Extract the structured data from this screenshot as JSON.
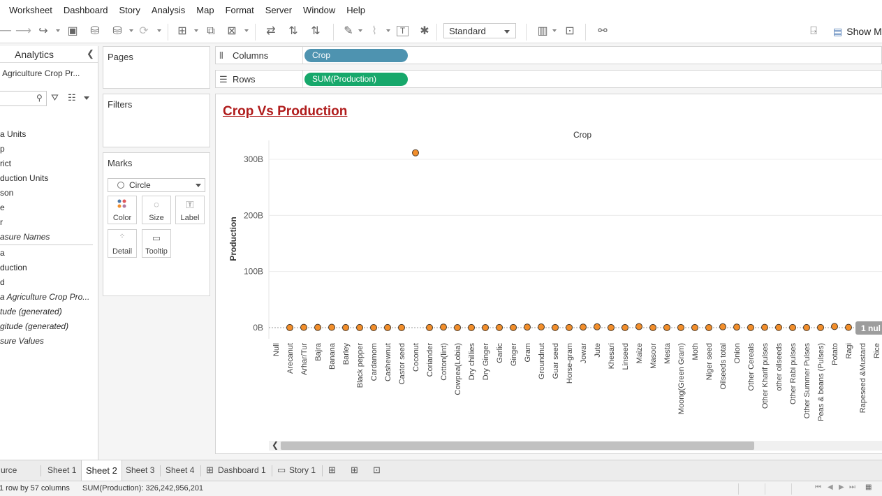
{
  "menu": [
    "Worksheet",
    "Dashboard",
    "Story",
    "Analysis",
    "Map",
    "Format",
    "Server",
    "Window",
    "Help"
  ],
  "toolbar": {
    "fit_value": "Standard",
    "show_me_label": "Show Me",
    "icons": [
      "back-icon",
      "forward-icon",
      "redo-icon",
      "save-icon",
      "new-datasource-icon",
      "pause-updates-icon",
      "refresh-icon",
      "new-worksheet-icon",
      "duplicate-sheet-icon",
      "clear-sheet-icon",
      "swap-rows-columns-icon",
      "sort-ascending-icon",
      "sort-descending-icon",
      "highlight-icon",
      "group-icon",
      "labels-icon",
      "pin-axes-icon",
      "show-cards-icon",
      "presentation-mode-icon",
      "share-icon",
      "format-workbook-icon",
      "show-me-icon"
    ]
  },
  "data_pane": {
    "tab_label": "Analytics",
    "datasource_name": "Agriculture Crop Pr...",
    "fields": [
      {
        "label": "a Units",
        "italic": false
      },
      {
        "label": "p",
        "italic": false
      },
      {
        "label": "rict",
        "italic": false
      },
      {
        "label": "duction Units",
        "italic": false
      },
      {
        "label": "son",
        "italic": false
      },
      {
        "label": "e",
        "italic": false
      },
      {
        "label": "r",
        "italic": false
      },
      {
        "label": "asure Names",
        "italic": true
      }
    ],
    "measures": [
      {
        "label": "a",
        "italic": false
      },
      {
        "label": "duction",
        "italic": false
      },
      {
        "label": "d",
        "italic": false
      },
      {
        "label": "a Agriculture Crop Pro...",
        "italic": true
      },
      {
        "label": "tude (generated)",
        "italic": true
      },
      {
        "label": "gitude (generated)",
        "italic": true
      },
      {
        "label": "sure Values",
        "italic": true
      }
    ]
  },
  "shelves": {
    "pages_label": "Pages",
    "filters_label": "Filters",
    "marks_label": "Marks",
    "mark_type": "Circle",
    "mark_buttons": [
      "Color",
      "Size",
      "Label",
      "Detail",
      "Tooltip"
    ],
    "columns_label": "Columns",
    "columns_pill": "Crop",
    "rows_label": "Rows",
    "rows_pill": "SUM(Production)"
  },
  "view": {
    "title": "Crop Vs Production",
    "null_badge": "1 nul"
  },
  "chart_data": {
    "type": "scatter",
    "title": "Crop Vs Production",
    "xlabel": "Crop",
    "ylabel": "Production",
    "ylim": [
      0,
      330
    ],
    "y_unit": "billions",
    "y_ticks": [
      "0B",
      "100B",
      "200B",
      "300B"
    ],
    "y_tick_values": [
      0,
      100,
      200,
      300
    ],
    "grid": true,
    "mark_color": "#f28e2b",
    "categories": [
      "Null",
      "Arecanut",
      "Arhar/Tur",
      "Bajra",
      "Banana",
      "Barley",
      "Black pepper",
      "Cardamom",
      "Cashewnut",
      "Castor seed",
      "Coconut",
      "Coriander",
      "Cotton(lint)",
      "Cowpea(Lobia)",
      "Dry chillies",
      "Dry Ginger",
      "Garlic",
      "Ginger",
      "Gram",
      "Groundnut",
      "Guar seed",
      "Horse-gram",
      "Jowar",
      "Jute",
      "Khesari",
      "Linseed",
      "Maize",
      "Masoor",
      "Mesta",
      "Moong(Green Gram)",
      "Moth",
      "Niger seed",
      "Oilseeds total",
      "Onion",
      "Other Cereals",
      "Other Kharif pulses",
      "other oilseeds",
      "Other Rabi pulses",
      "Other Summer Pulses",
      "Peas & beans (Pulses)",
      "Potato",
      "Ragi",
      "Rapeseed &Mustard",
      "Rice"
    ],
    "values": [
      null,
      0.1,
      0.5,
      0.4,
      0.6,
      0.1,
      0.1,
      0.05,
      0.1,
      0.1,
      311.5,
      0.1,
      1.0,
      0.05,
      0.1,
      0.05,
      0.2,
      0.2,
      1.0,
      1.2,
      0.2,
      0.2,
      1.0,
      1.5,
      0.1,
      0.1,
      1.8,
      0.1,
      0.2,
      0.2,
      0.1,
      0.05,
      1.5,
      1.0,
      0.2,
      0.5,
      0.3,
      0.2,
      0.1,
      0.2,
      2.0,
      0.5,
      0.8,
      5.0
    ]
  },
  "tabs": {
    "datasource_fragment": "urce",
    "sheets": [
      "Sheet 1",
      "Sheet 2",
      "Sheet 3",
      "Sheet 4"
    ],
    "active": "Sheet 2",
    "dashboard": "Dashboard 1",
    "story": "Story 1"
  },
  "status": {
    "rows_info": "1 row by 57 columns",
    "sum_info": "SUM(Production): 326,242,956,201"
  }
}
